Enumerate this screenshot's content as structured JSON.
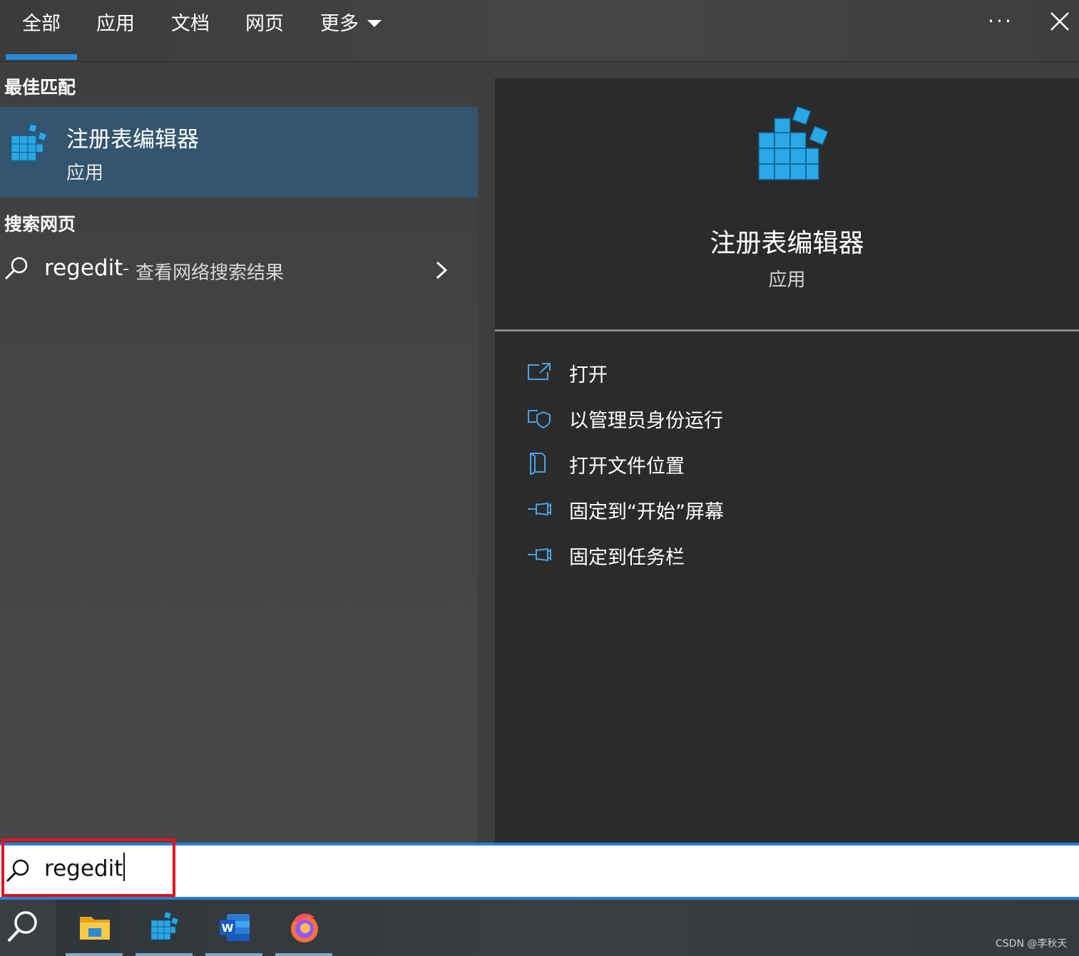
{
  "tabs": [
    {
      "label": "全部",
      "active": true
    },
    {
      "label": "应用",
      "active": false
    },
    {
      "label": "文档",
      "active": false
    },
    {
      "label": "网页",
      "active": false
    },
    {
      "label": "更多",
      "active": false
    }
  ],
  "header": {
    "more_icon": "ellipsis-icon",
    "close_icon": "close-icon",
    "more_dots": "···"
  },
  "best_match": {
    "section_title": "最佳匹配",
    "app_name": "注册表编辑器",
    "app_type": "应用",
    "icon": "registry-editor-icon"
  },
  "web_search": {
    "section_title": "搜索网页",
    "query": "regedit",
    "separator": "-",
    "description": "查看网络搜索结果",
    "icon": "search-icon"
  },
  "detail": {
    "app_name": "注册表编辑器",
    "app_type": "应用",
    "actions": [
      {
        "label": "打开",
        "icon": "open-icon"
      },
      {
        "label": "以管理员身份运行",
        "icon": "run-as-admin-icon"
      },
      {
        "label": "打开文件位置",
        "icon": "file-location-icon"
      },
      {
        "label": "固定到“开始”屏幕",
        "icon": "pin-icon"
      },
      {
        "label": "固定到任务栏",
        "icon": "pin-icon"
      }
    ]
  },
  "search": {
    "value": "regedit",
    "placeholder": ""
  },
  "taskbar": {
    "apps": [
      "file-explorer-icon",
      "registry-editor-icon",
      "word-icon",
      "firefox-icon"
    ]
  },
  "colors": {
    "accent": "#2a8ad8",
    "selection": "#33556f",
    "highlight_box": "#e3121a",
    "icon_blue": "#29a8e6"
  },
  "watermark": "CSDN @李秋天"
}
